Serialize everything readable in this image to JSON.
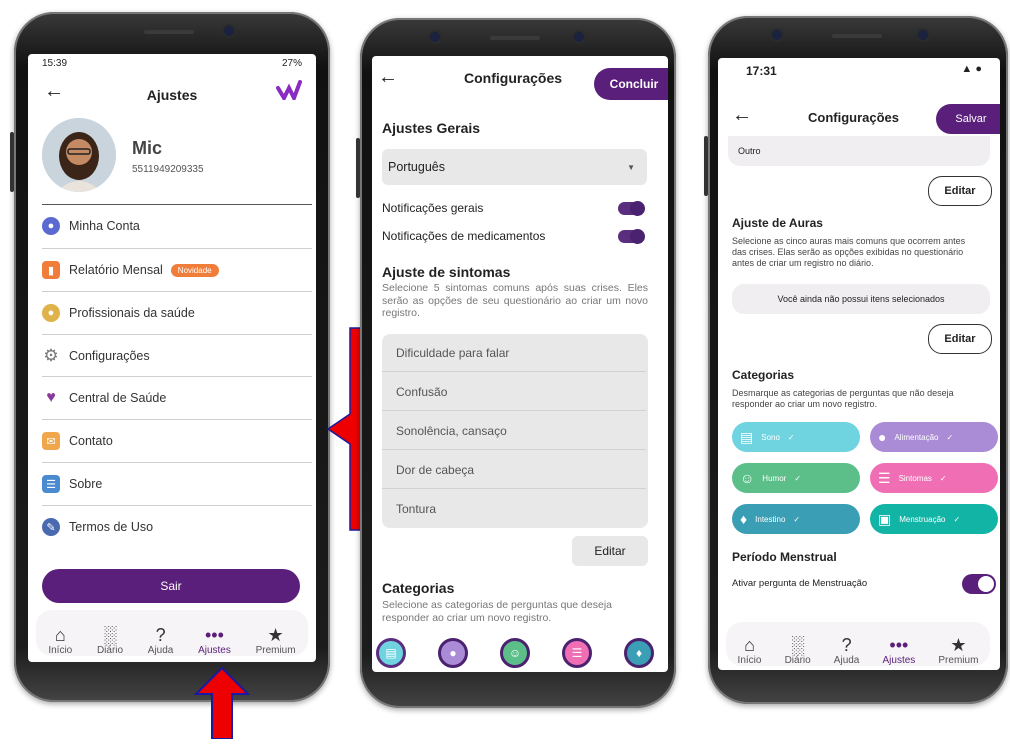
{
  "phone1": {
    "status_time": "15:39",
    "status_right": "27%",
    "title": "Ajustes",
    "user_name": "Mic",
    "user_phone": "5511949209335",
    "menu": [
      {
        "label": "Minha Conta",
        "icon": "user-icon"
      },
      {
        "label": "Relatório Mensal",
        "icon": "report-icon",
        "badge": "Novidade"
      },
      {
        "label": "Profissionais da saúde",
        "icon": "doctor-icon"
      },
      {
        "label": "Configurações",
        "icon": "gear-icon"
      },
      {
        "label": "Central de Saúde",
        "icon": "heart-icon"
      },
      {
        "label": "Contato",
        "icon": "mail-icon"
      },
      {
        "label": "Sobre",
        "icon": "info-icon"
      },
      {
        "label": "Termos de Uso",
        "icon": "terms-icon"
      }
    ],
    "logout": "Sair",
    "nav": [
      "Início",
      "Diário",
      "Ajuda",
      "Ajustes",
      "Premium"
    ]
  },
  "phone2": {
    "title": "Configurações",
    "done": "Concluir",
    "general_title": "Ajustes Gerais",
    "language": "Português",
    "notif_general": "Notificações gerais",
    "notif_meds": "Notificações de medicamentos",
    "symptoms_title": "Ajuste de sintomas",
    "symptoms_desc": "Selecione 5 sintomas comuns após suas crises. Eles serão as opções de seu questionário ao criar um novo registro.",
    "symptoms": [
      "Dificuldade para falar",
      "Confusão",
      "Sonolência, cansaço",
      "Dor de cabeça",
      "Tontura"
    ],
    "edit": "Editar",
    "categories_title": "Categorias",
    "categories_desc": "Selecione as categorias de perguntas que deseja responder ao criar um novo registro."
  },
  "phone3": {
    "status_time": "17:31",
    "title": "Configurações",
    "save": "Salvar",
    "other": "Outro",
    "edit1": "Editar",
    "auras_title": "Ajuste de Auras",
    "auras_desc": "Selecione as cinco auras mais comuns que ocorrem antes das crises. Elas serão as opções exibidas no questionário antes de criar um registro no diário.",
    "no_items": "Você ainda não possui itens selecionados",
    "edit2": "Editar",
    "categories_title": "Categorias",
    "categories_desc": "Desmarque as categorias de perguntas que não deseja responder ao criar um novo registro.",
    "categories": [
      {
        "label": "Sono",
        "color": "#6fd3e0"
      },
      {
        "label": "Alimentação",
        "color": "#a98bd6"
      },
      {
        "label": "Humor",
        "color": "#5cbf8a"
      },
      {
        "label": "Sintomas",
        "color": "#f06fb4"
      },
      {
        "label": "Intestino",
        "color": "#3a9eb5"
      },
      {
        "label": "Menstruação",
        "color": "#12b5a5"
      }
    ],
    "period_title": "Período Menstrual",
    "period_toggle": "Ativar pergunta de Menstruação",
    "nav": [
      "Início",
      "Diário",
      "Ajuda",
      "Ajustes",
      "Premium"
    ]
  },
  "colors": {
    "accent": "#5a1f7a",
    "arrow": "#ee0000"
  }
}
